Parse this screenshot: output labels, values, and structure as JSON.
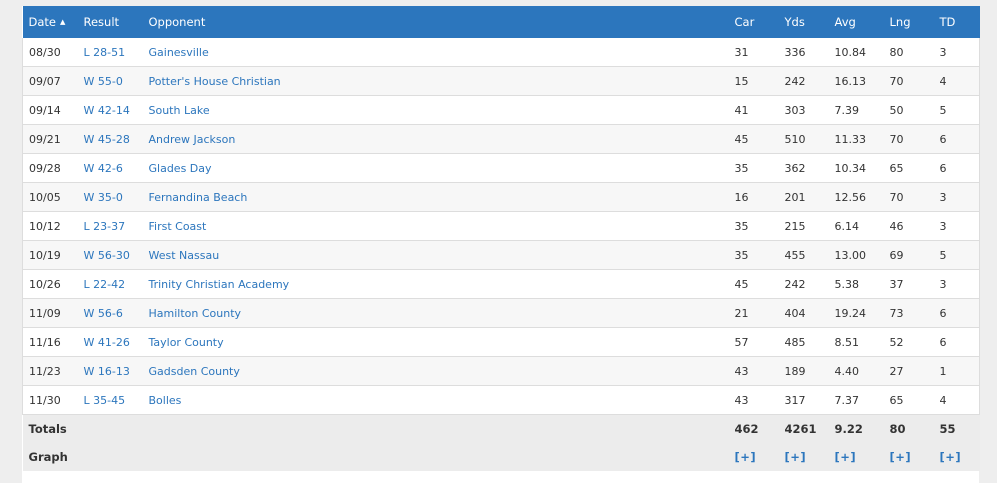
{
  "columns": {
    "date": "Date",
    "result": "Result",
    "opponent": "Opponent",
    "car": "Car",
    "yds": "Yds",
    "avg": "Avg",
    "lng": "Lng",
    "td": "TD",
    "sort_indicator": "▲"
  },
  "games": [
    {
      "date": "08/30",
      "result": "L 28-51",
      "opponent": "Gainesville",
      "car": "31",
      "yds": "336",
      "avg": "10.84",
      "lng": "80",
      "td": "3"
    },
    {
      "date": "09/07",
      "result": "W 55-0",
      "opponent": "Potter's House Christian",
      "car": "15",
      "yds": "242",
      "avg": "16.13",
      "lng": "70",
      "td": "4"
    },
    {
      "date": "09/14",
      "result": "W 42-14",
      "opponent": "South Lake",
      "car": "41",
      "yds": "303",
      "avg": "7.39",
      "lng": "50",
      "td": "5"
    },
    {
      "date": "09/21",
      "result": "W 45-28",
      "opponent": "Andrew Jackson",
      "car": "45",
      "yds": "510",
      "avg": "11.33",
      "lng": "70",
      "td": "6"
    },
    {
      "date": "09/28",
      "result": "W 42-6",
      "opponent": "Glades Day",
      "car": "35",
      "yds": "362",
      "avg": "10.34",
      "lng": "65",
      "td": "6"
    },
    {
      "date": "10/05",
      "result": "W 35-0",
      "opponent": "Fernandina Beach",
      "car": "16",
      "yds": "201",
      "avg": "12.56",
      "lng": "70",
      "td": "3"
    },
    {
      "date": "10/12",
      "result": "L 23-37",
      "opponent": "First Coast",
      "car": "35",
      "yds": "215",
      "avg": "6.14",
      "lng": "46",
      "td": "3"
    },
    {
      "date": "10/19",
      "result": "W 56-30",
      "opponent": "West Nassau",
      "car": "35",
      "yds": "455",
      "avg": "13.00",
      "lng": "69",
      "td": "5"
    },
    {
      "date": "10/26",
      "result": "L 22-42",
      "opponent": "Trinity Christian Academy",
      "car": "45",
      "yds": "242",
      "avg": "5.38",
      "lng": "37",
      "td": "3"
    },
    {
      "date": "11/09",
      "result": "W 56-6",
      "opponent": "Hamilton County",
      "car": "21",
      "yds": "404",
      "avg": "19.24",
      "lng": "73",
      "td": "6"
    },
    {
      "date": "11/16",
      "result": "W 41-26",
      "opponent": "Taylor County",
      "car": "57",
      "yds": "485",
      "avg": "8.51",
      "lng": "52",
      "td": "6"
    },
    {
      "date": "11/23",
      "result": "W 16-13",
      "opponent": "Gadsden County",
      "car": "43",
      "yds": "189",
      "avg": "4.40",
      "lng": "27",
      "td": "1"
    },
    {
      "date": "11/30",
      "result": "L 35-45",
      "opponent": "Bolles",
      "car": "43",
      "yds": "317",
      "avg": "7.37",
      "lng": "65",
      "td": "4"
    }
  ],
  "totals": {
    "label": "Totals",
    "car": "462",
    "yds": "4261",
    "avg": "9.22",
    "lng": "80",
    "td": "55"
  },
  "graph": {
    "label": "Graph",
    "car": "[+]",
    "yds": "[+]",
    "avg": "[+]",
    "lng": "[+]",
    "td": "[+]"
  },
  "colors": {
    "header_bg": "#2c76bd",
    "link": "#2c76bd",
    "footer_bg": "#ececec",
    "page_bg": "#eeeeee"
  }
}
